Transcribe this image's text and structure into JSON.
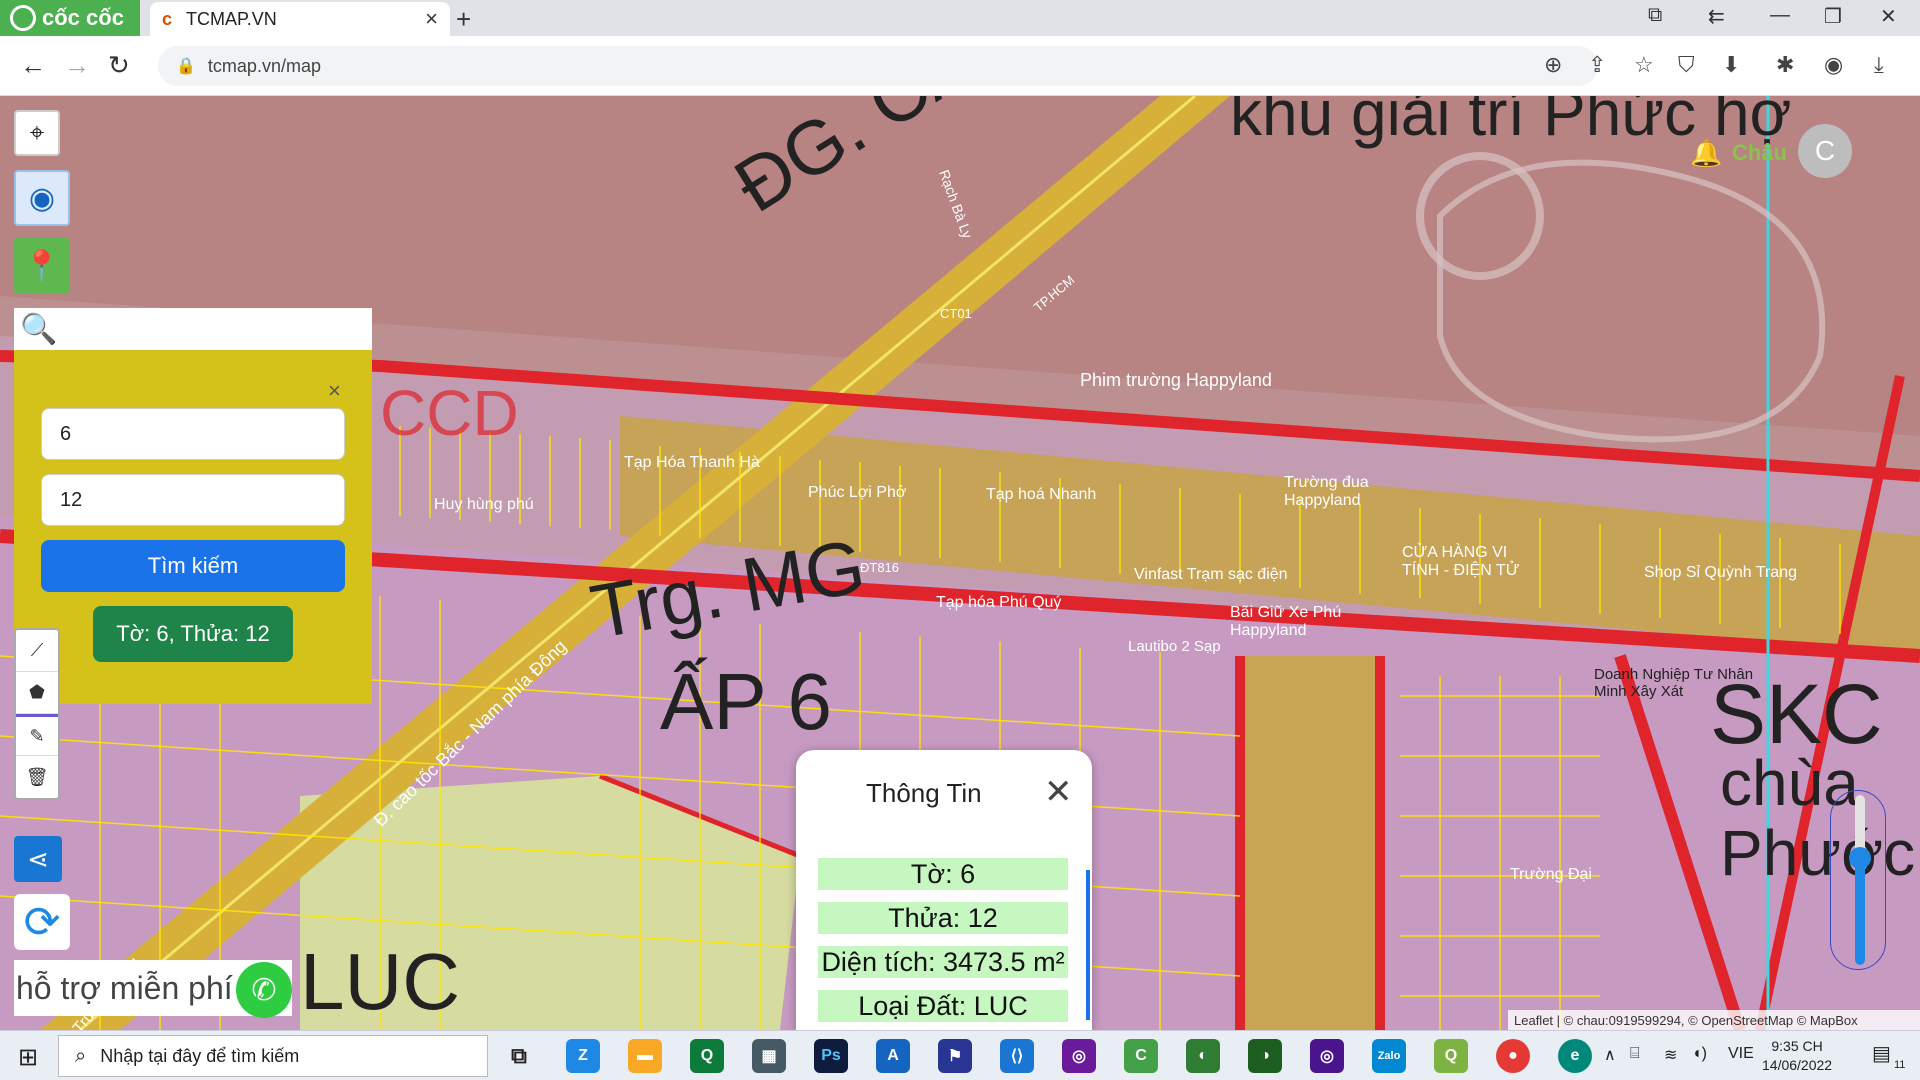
{
  "browser": {
    "brand": "cốc cốc",
    "tab_title": "TCMAP.VN",
    "url": "tcmap.vn/map"
  },
  "map": {
    "labels": {
      "road_big": "ĐG. CA",
      "road_top": "khu giải trí Phức hợ",
      "kcd": "CCD",
      "mg": "Trg. MG",
      "ap6": "ẤP 6",
      "luc": "LUC",
      "skc": "SKC",
      "chua": "chùa",
      "phuoc": "Phước",
      "happyland": "Phim trường Happyland",
      "truong_dua": "Trường đua Happyland",
      "tap_hoa_thanh_ha": "Tạp Hóa Thanh Hà",
      "phuc_loi_pho": "Phúc Lợi Phở",
      "tap_hoa_nhanh": "Tạp hoá Nhanh",
      "cua_hang": "CỬA HÀNG VI TÍNH - ĐIỆN TỬ",
      "shop_si": "Shop Sỉ Quỳnh Trang",
      "vinfast": "Vinfast Trạm sạc điện",
      "bai_giu_xe": "Bãi Giữ Xe Phú Happyland",
      "tap_hoa_phu_quy": "Tạp hóa Phú Quý",
      "huy_hung_phu": "Huy hùng phú",
      "highway": "Đ. cao tốc Bắc - Nam phía Đông",
      "dt816": "ĐT816",
      "ct01": "CT01",
      "tp_hcm": "TP.HCM",
      "rach_ba_ly": "Rạch Bà Ly",
      "doanh_nghiep": "Doanh Nghiệp Tư Nhân Minh Xây Xát",
      "truong_dai": "Trường Đại",
      "trung_luong": "Trung Lương",
      "lautibo": "Lautibo 2 Sạp"
    }
  },
  "search_panel": {
    "input_to": "6",
    "input_thua": "12",
    "search_button": "Tìm kiếm",
    "result": "Tờ: 6, Thửa: 12",
    "close": "×"
  },
  "user": {
    "name": "Châu",
    "avatar_letter": "C"
  },
  "support": {
    "text": "hỗ trợ miễn phí"
  },
  "info_popup": {
    "title": "Thông Tin",
    "rows": [
      "Tờ: 6",
      "Thửa: 12",
      "Diện tích: 3473.5 m²",
      "Loại Đất: LUC"
    ]
  },
  "attribution": "Leaflet | © chau:0919599294, © OpenStreetMap © MapBox",
  "taskbar": {
    "search_placeholder": "Nhập tại đây để tìm kiếm",
    "language": "VIE",
    "time": "9:35 CH",
    "date": "14/06/2022",
    "notif_count": "11"
  },
  "colors": {
    "panel": "#d4c11a",
    "search_btn": "#1a73e8",
    "result_chip": "#1e8449",
    "info_row": "#c6f7c0",
    "parcel_line": "#ffe600",
    "zone_border": "#e0242c"
  }
}
